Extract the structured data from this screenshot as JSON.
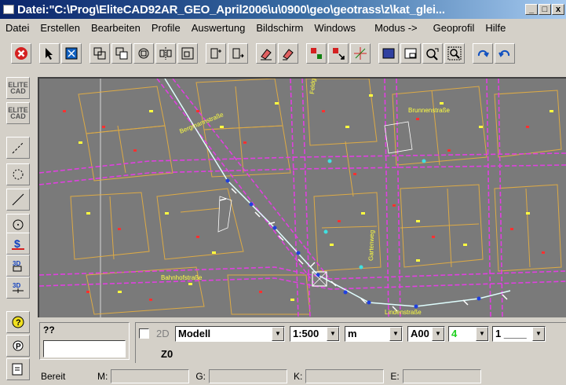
{
  "window": {
    "title": "Datei:\"C:\\Prog\\EliteCAD92AR_GEO_April2006\\u\\0900\\geo\\geotrass\\z\\kat_glei..."
  },
  "window_buttons": [
    "_",
    "□",
    "x"
  ],
  "menu": [
    "Datei",
    "Erstellen",
    "Bearbeiten",
    "Profile",
    "Auswertung",
    "Bildschirm",
    "Windows",
    "Modus ->",
    "Geoprofil",
    "Hilfe"
  ],
  "toolbar": {
    "icons": [
      "stop-icon",
      "select-arrow-icon",
      "select-window-icon",
      "copy-icon",
      "move-icon",
      "rotate-icon",
      "mirror-icon",
      "scale-icon",
      "layer-add-icon",
      "layer-move-icon",
      "eraser-icon",
      "eraser-partial-icon",
      "red-point-icon",
      "red-point-arrow-icon",
      "snap-cross-icon",
      "display-icon",
      "window-icon",
      "zoom-back-icon",
      "zoom-window-icon",
      "redo-icon",
      "undo-icon"
    ]
  },
  "left_tools": {
    "elite1": "ELITE CAD",
    "elite2": "ELITE CAD",
    "icons": [
      "polyline-icon",
      "circle-dotted-icon",
      "line-icon",
      "circle-point-icon",
      "dollar-transform-icon",
      "3d-box-icon",
      "3d-plus-icon",
      "help-icon",
      "point-icon",
      "layout-icon"
    ]
  },
  "map": {
    "labels": [
      {
        "t": "Bergmannstraße"
      },
      {
        "t": "Lindenstraße"
      },
      {
        "t": "Feldgasse"
      },
      {
        "t": "Gartenweg"
      },
      {
        "t": "Bahnhofstraße"
      },
      {
        "t": "Brunnenstraße"
      }
    ]
  },
  "status_panel": {
    "label": "??",
    "input": ""
  },
  "prop_bar": {
    "mode_2d": "2D",
    "model": "Modell",
    "scale": "1:500",
    "unit": "m",
    "layer": "A00",
    "color": "4",
    "linetype": "1 ____",
    "z_label": "Z0"
  },
  "statusbar": {
    "status": "Bereit",
    "m_label": "M:",
    "g_label": "G:",
    "k_label": "K:",
    "e_label": "E:"
  },
  "colors": {
    "canvas_bg": "#7a7a7a",
    "street_lines": "#e040e0",
    "parcel_lines": "#e8b040",
    "track": "#e0ffff"
  }
}
